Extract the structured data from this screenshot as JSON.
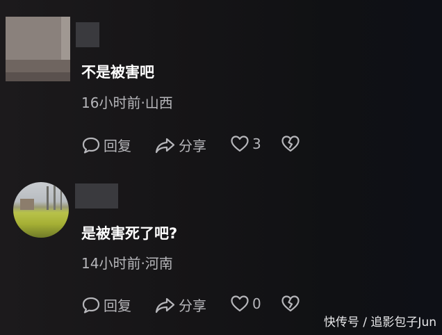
{
  "comments": [
    {
      "text": "不是被害吧",
      "meta": "16小时前·山西",
      "reply_label": "回复",
      "share_label": "分享",
      "like_count": "3"
    },
    {
      "text": "是被害死了吧?",
      "meta": "14小时前·河南",
      "reply_label": "回复",
      "share_label": "分享",
      "like_count": "0"
    }
  ],
  "watermark": "快传号 / 追影包子Jun",
  "icons": [
    "comment-bubble-icon",
    "share-arrow-icon",
    "heart-icon",
    "broken-heart-icon"
  ],
  "colors": {
    "text": "#ffffff",
    "meta": "#b6b6ba",
    "background": "#151416"
  }
}
